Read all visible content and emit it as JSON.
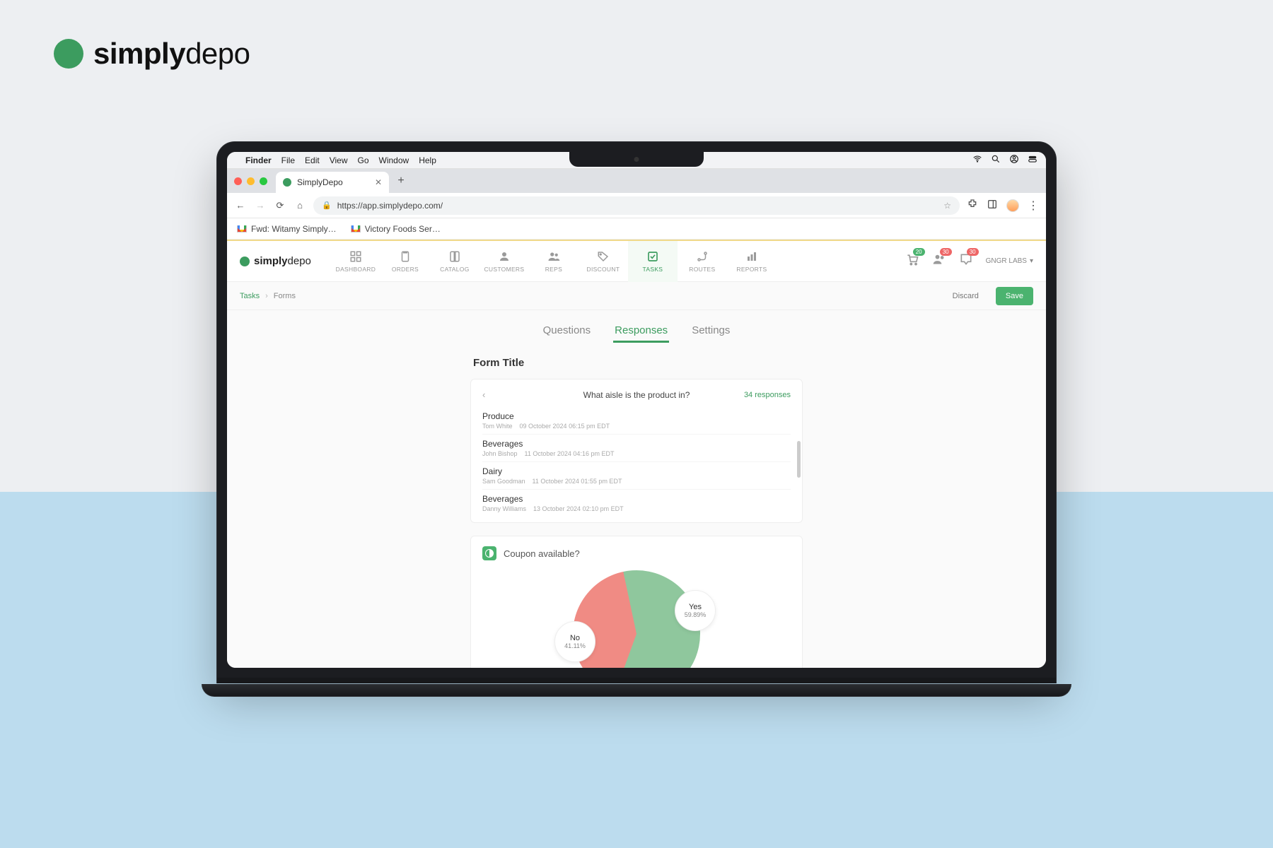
{
  "brand": {
    "name_strong": "simply",
    "name_light": "depo"
  },
  "mac_menubar": {
    "app": "Finder",
    "items": [
      "File",
      "Edit",
      "View",
      "Go",
      "Window",
      "Help"
    ]
  },
  "browser": {
    "tab_title": "SimplyDepo",
    "url": "https://app.simplydepo.com/",
    "bookmarks": [
      "Fwd: Witamy Simply…",
      "Victory Foods Ser…"
    ]
  },
  "nav_items": [
    {
      "key": "dashboard",
      "label": "DASHBOARD"
    },
    {
      "key": "orders",
      "label": "ORDERS"
    },
    {
      "key": "catalog",
      "label": "CATALOG"
    },
    {
      "key": "customers",
      "label": "CUSTOMERS"
    },
    {
      "key": "reps",
      "label": "REPS"
    },
    {
      "key": "discount",
      "label": "DISCOUNT"
    },
    {
      "key": "tasks",
      "label": "TASKS"
    },
    {
      "key": "routes",
      "label": "ROUTES"
    },
    {
      "key": "reports",
      "label": "REPORTS"
    }
  ],
  "header": {
    "cart_badge": "20",
    "user_badge": "30",
    "chat_badge": "30",
    "org": "GNGR LABS"
  },
  "breadcrumb": {
    "root": "Tasks",
    "current": "Forms",
    "discard": "Discard",
    "save": "Save"
  },
  "tabs": {
    "questions": "Questions",
    "responses": "Responses",
    "settings": "Settings"
  },
  "form": {
    "title": "Form Title",
    "question": "What aisle is the product in?",
    "response_count": "34 responses",
    "responses": [
      {
        "value": "Produce",
        "user": "Tom White",
        "time": "09 October 2024 06:15 pm EDT"
      },
      {
        "value": "Beverages",
        "user": "John Bishop",
        "time": "11 October 2024 04:16 pm EDT"
      },
      {
        "value": "Dairy",
        "user": "Sam Goodman",
        "time": "11 October 2024 01:55 pm EDT"
      },
      {
        "value": "Beverages",
        "user": "Danny Williams",
        "time": "13 October 2024 02:10 pm EDT"
      }
    ]
  },
  "coupon": {
    "title": "Coupon available?",
    "yes_label": "Yes",
    "yes_pct": "59.89%",
    "no_label": "No",
    "no_pct": "41.11%"
  },
  "chart_data": {
    "type": "pie",
    "title": "Coupon available?",
    "categories": [
      "Yes",
      "No"
    ],
    "values": [
      59.89,
      41.11
    ],
    "colors": {
      "Yes": "#8fc79d",
      "No": "#f08b84"
    }
  }
}
